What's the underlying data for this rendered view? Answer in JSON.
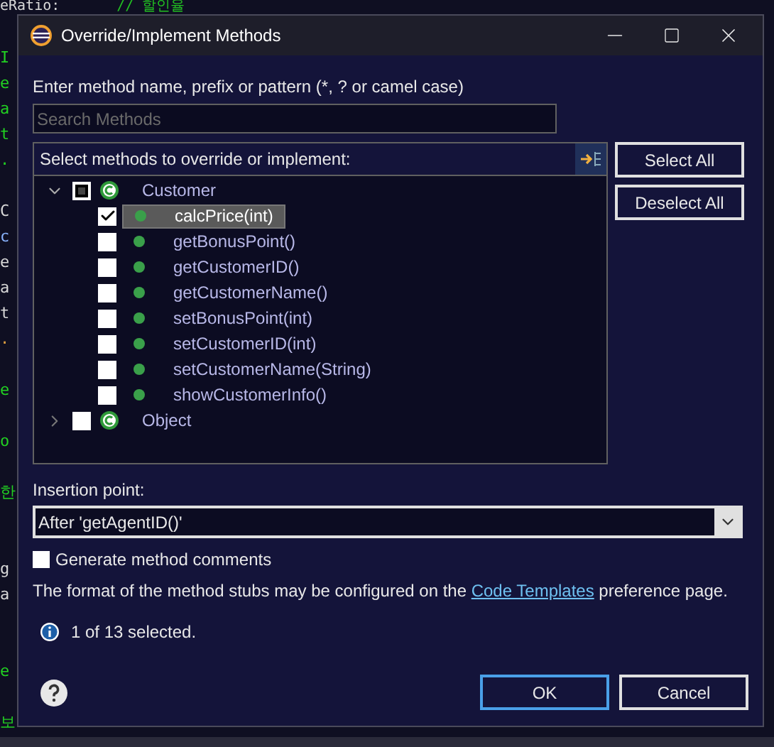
{
  "editor": {
    "top_line": [
      {
        "text": "eRatio:",
        "color": "#d8d8d8"
      },
      {
        "text": "// 할인율",
        "color": "#22c022"
      }
    ],
    "lines": [
      {
        "kind": "code",
        "text": "I",
        "color": "#22d022"
      },
      {
        "kind": "code",
        "text": "e",
        "color": "#22d022"
      },
      {
        "kind": "code",
        "text": "a",
        "color": "#22d022"
      },
      {
        "kind": "code",
        "text": "t",
        "color": "#22d022"
      },
      {
        "kind": "code",
        "text": ".",
        "color": "#22d022"
      },
      {
        "kind": "blank"
      },
      {
        "kind": "code",
        "text": "C",
        "color": "#d8d8d8"
      },
      {
        "kind": "code",
        "text": "c",
        "color": "#8ab4ff"
      },
      {
        "kind": "code",
        "text": "e",
        "color": "#d8d8d8"
      },
      {
        "kind": "code",
        "text": "a",
        "color": "#d8d8d8"
      },
      {
        "kind": "code",
        "text": "t",
        "color": "#d8d8d8"
      },
      {
        "kind": "code",
        "text": ".",
        "color": "#e0a040"
      },
      {
        "kind": "blank"
      },
      {
        "kind": "code",
        "text": "e",
        "color": "#22d022"
      },
      {
        "kind": "blank"
      },
      {
        "kind": "code",
        "text": "o",
        "color": "#22d022"
      },
      {
        "kind": "blank"
      },
      {
        "kind": "code",
        "text": "한",
        "color": "#22d022"
      },
      {
        "kind": "blank"
      },
      {
        "kind": "blank"
      },
      {
        "kind": "code",
        "text": "g",
        "color": "#d8d8d8"
      },
      {
        "kind": "code",
        "text": "a",
        "color": "#d8d8d8"
      },
      {
        "kind": "blank"
      },
      {
        "kind": "blank"
      },
      {
        "kind": "code",
        "text": "e",
        "color": "#22d022"
      },
      {
        "kind": "blank"
      },
      {
        "kind": "code",
        "text": "보",
        "color": "#22d022"
      }
    ]
  },
  "dialog": {
    "title": "Override/Implement Methods",
    "prompt": "Enter method name, prefix or pattern (*, ? or camel case)",
    "search": {
      "placeholder": "Search Methods"
    },
    "list_header": "Select methods to override or implement:",
    "tree": [
      {
        "label": "Customer",
        "expanded": true,
        "checked": false,
        "mixed": true,
        "children": [
          {
            "label": "calcPrice(int)",
            "checked": true,
            "selected": true
          },
          {
            "label": "getBonusPoint()",
            "checked": false,
            "selected": false
          },
          {
            "label": "getCustomerID()",
            "checked": false,
            "selected": false
          },
          {
            "label": "getCustomerName()",
            "checked": false,
            "selected": false
          },
          {
            "label": "setBonusPoint(int)",
            "checked": false,
            "selected": false
          },
          {
            "label": "setCustomerID(int)",
            "checked": false,
            "selected": false
          },
          {
            "label": "setCustomerName(String)",
            "checked": false,
            "selected": false
          },
          {
            "label": "showCustomerInfo()",
            "checked": false,
            "selected": false
          }
        ]
      },
      {
        "label": "Object",
        "expanded": false,
        "checked": false,
        "mixed": false
      }
    ],
    "side_buttons": [
      "Select All",
      "Deselect All"
    ],
    "insertion_label": "Insertion point:",
    "insertion_value": "After 'getAgentID()'",
    "generate_comments": {
      "label": "Generate method comments",
      "checked": false
    },
    "info": {
      "before": "The format of the method stubs may be configured on the ",
      "link": "Code Templates",
      "after": " preference page."
    },
    "status": "1 of 13 selected.",
    "buttons": [
      {
        "label": "OK",
        "default": true
      },
      {
        "label": "Cancel",
        "default": false
      }
    ]
  }
}
